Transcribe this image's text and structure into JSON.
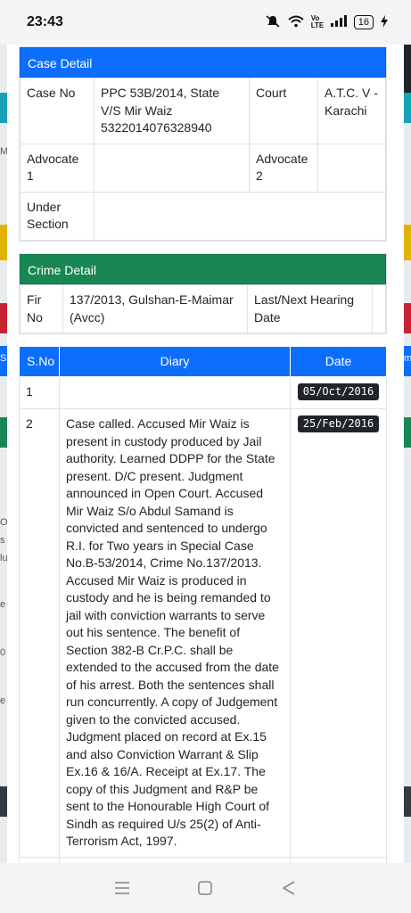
{
  "status_bar": {
    "time": "23:43",
    "battery": "16",
    "network_label": "Vo LTE"
  },
  "case_detail": {
    "header": "Case Detail",
    "case_no_label": "Case No",
    "case_no_value": "PPC 53B/2014, State V/S Mir Waiz 5322014076328940",
    "court_label": "Court",
    "court_value": "A.T.C. V - Karachi",
    "advocate1_label": "Advocate 1",
    "advocate1_value": "",
    "advocate2_label": "Advocate 2",
    "advocate2_value": "",
    "under_section_label": "Under Section",
    "under_section_value": ""
  },
  "crime_detail": {
    "header": "Crime Detail",
    "fir_label": "Fir No",
    "fir_value": "137/2013, Gulshan-E-Maimar (Avcc)",
    "hearing_label": "Last/Next Hearing Date",
    "hearing_value": ""
  },
  "diary": {
    "columns": [
      "S.No",
      "Diary",
      "Date"
    ],
    "rows": [
      {
        "sno": "1",
        "text": "",
        "date": "05/Oct/2016"
      },
      {
        "sno": "2",
        "text": "Case called. Accused Mir Waiz is present in custody produced by Jail authority. Learned DDPP for the State present. D/C present. Judgment announced in Open Court. Accused Mir Waiz S/o Abdul Samand is convicted and sentenced to undergo R.I. for Two years in Special Case No.B-53/2014, Crime No.137/2013. Accused Mir Waiz is produced in custody and he is being remanded to jail with conviction warrants to serve out his sentence. The benefit of Section 382-B Cr.P.C. shall be extended to the accused from the date of his arrest. Both the sentences shall run concurrently. A copy of Judgement given to the convicted accused. Judgment placed on record at Ex.15 and also Conviction Warrant & Slip Ex.16 & 16/A. Receipt at Ex.17. The copy of this Judgment and R&P be sent to the Honourable High Court of Sindh as required U/s 25(2) of Anti-Terrorism Act, 1997.",
        "date": "25/Feb/2016"
      }
    ]
  },
  "background_edge": {
    "left_letters": [
      "O",
      "s",
      "lu",
      "e",
      "0",
      "e"
    ],
    "left_m": "M",
    "left_s": "S",
    "right_m": "m"
  },
  "colors": {
    "primary": "#0d6efd",
    "success": "#198754",
    "dark": "#212529"
  }
}
